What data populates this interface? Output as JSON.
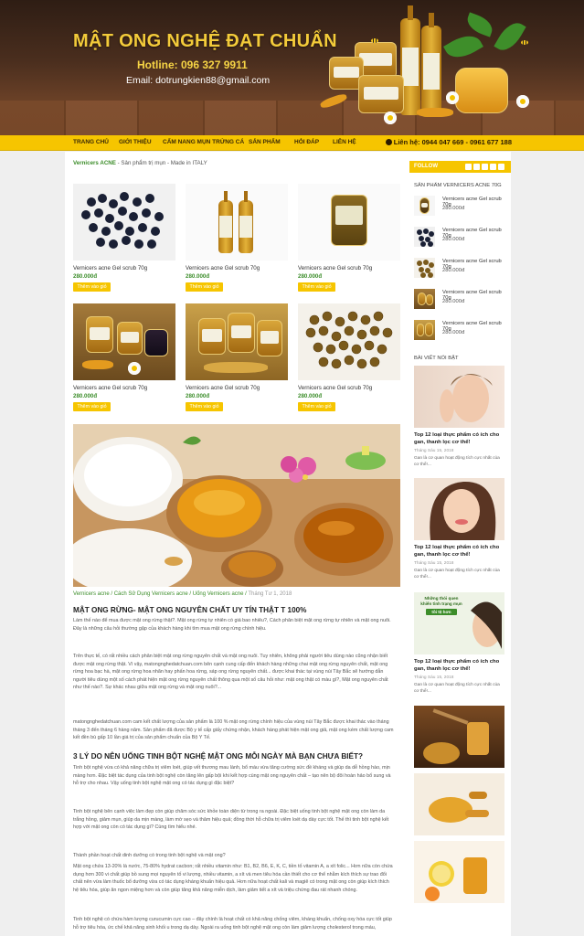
{
  "header": {
    "site_title": "MẬT ONG NGHỆ ĐẠT CHUẨN",
    "hotline": "Hotline: 096 327 9911",
    "email": "Email: dotrungkien88@gmail.com"
  },
  "nav": {
    "items": [
      "TRANG CHỦ",
      "GIỚI THIỆU",
      "CẨM NANG MỤN TRỨNG CÁ",
      "SẢN PHẨM",
      "HỎI ĐÁP",
      "LIÊN HỆ"
    ],
    "contact": "Liên hệ: 0944 047 669 - 0961 677 188"
  },
  "breadcrumb": {
    "link": "Vernicers ACNE",
    "text": "- Sản phẩm trị mụn - Made in ITALY"
  },
  "products": [
    {
      "name": "Vernicers acne Gel scrub 70g",
      "price": "280.000đ",
      "cart": "Thêm vào giỏ"
    },
    {
      "name": "Vernicers acne Gel scrub 70g",
      "price": "280.000đ",
      "cart": "Thêm vào giỏ"
    },
    {
      "name": "Vernicers acne Gel scrub 70g",
      "price": "280.000đ",
      "cart": "Thêm vào giỏ"
    },
    {
      "name": "Vernicers acne Gel scrub 70g",
      "price": "280.000đ",
      "cart": "Thêm vào giỏ"
    },
    {
      "name": "Vernicers acne Gel scrub 70g",
      "price": "280.000đ",
      "cart": "Thêm vào giỏ"
    },
    {
      "name": "Vernicers acne Gel scrub 70g",
      "price": "280.000đ",
      "cart": "Thêm vào giỏ"
    }
  ],
  "article": {
    "meta_links": "Vernicers acne / Cách Sử Dụng Vernicers acne / Uống Vernicers acne /",
    "meta_date": "Tháng Tư 1, 2018",
    "title": "MẬT ONG RỪNG- MẬT ONG NGUYÊN CHẤT UY TÍN THẬT T 100%",
    "p1": "Làm thế nào để mua được mật ong rừng thật?. Mật ong rừng tự nhiên có giá bao nhiêu?, Cách phân biệt mật ong rừng tự nhiên và mật ong nuôi. Đây là những câu hỏi thường gặp của khách hàng khi tìm mua mật ong rừng chính hiệu.",
    "p2": "Trên thực tế, có rất nhiều cách phân biệt mật ong rừng nguyên chất và mật ong nuôi. Tuy nhiên, không phải người tiêu dùng nào cũng nhận biết được mật ong rừng thật. Vì vậy, matongnghedatchuan.com bên cạnh cung cấp đến khách hàng những chai mật ong rừng nguyên chất, mật ong rừng hoa bạc hà, mật ong rừng hoa nhãn hay phấn hoa rừng, sáp ong rừng nguyên chất... được khai thác tại vùng núi Tây Bắc sẽ hướng dẫn người tiêu dùng một số cách phát hiện mật ong rừng nguyên chất thông qua một số câu hỏi như: mật ong thật có màu gì?, Mật ong nguyên chất như thế nào?. Sự khác nhau giữa mật ong rừng và mật ong nuôi?...",
    "p3": "matongnghedatchuan.com cam kết chất lượng của sản phẩm là 100 % mật ong rừng chính hiệu của vùng núi Tây Bắc được khai thác vào tháng tháng 3 đến tháng 6 hàng năm. Sản phẩm đã được Bộ y tế cấp giấy chứng nhận, khách hàng phát hiện mật ong giả, mật ong kém chất lượng cam kết đền bù gấp 10 lần giá trị của sản phẩm chuẩn của Bộ Y Tế.",
    "h2": "3 LÝ DO NÊN UỐNG TINH BỘT NGHỆ MẬT ONG MỖI NGÀY MÀ BẠN CHƯA BIẾT?",
    "p4": "Tinh bột nghệ vừa có khả năng chữa trị viêm loét, giúp vết thương mau lành, bổ máu vừa tăng cường sức đề kháng và giúp da dễ hồng hào, mịn màng hơn. Đặc biệt tác dụng của tinh bột nghệ còn tăng lên gấp bội khi kết hợp cùng mật ong nguyên chất – tạo nên bộ đôi hoàn hảo bổ sung và hỗ trợ cho nhau. Vậy uống tinh bột nghệ mật ong có tác dụng gì đặc biệt?",
    "p5": "Tinh bột nghệ bên cạnh việc làm đẹp còn giúp chăm sóc sức khỏe toàn diện từ trong ra ngoài. Đặc biệt uống tinh bột nghệ mật ong còn làm da trắng hồng, giảm mụn, giúp da mịn màng, làm mờ sẹo và thâm hiệu quả; đồng thời hỗ chữa trị viêm loét dạ dày cực tốt. Thế thì tinh bột nghệ kết hợp với mật ong còn có tác dụng gì? Cùng tìm hiểu nhé.",
    "p6": "Thành phần hoạt chất dinh dưỡng có trong tinh bột nghệ và mật ong?",
    "p7": "Mật ong chứa 13-20% là nước, 75-80% hydrat cacbon; rất nhiều vitamin như: B1, B2, B6, E, K, C, tiền tố vitamin A, a xít folic... Hơn nữa còn chứa dụng hơn 300 vi chất giúp bồ sung mọi nguyên tố vi lượng, nhiều vitamin, a xít và men tiêu hóa cần thiết cho cơ thể nhằm kích thích sự trao đổi chất nên vừa làm thuốc bổ dưỡng vừa có tác dụng kháng khuẩn hiệu quả. Hơn nữa hoạt chất kali và magiê có trong mật ong còn giúp kích thích hệ tiêu hóa, giúp ăn ngon miệng hơn và còn giúp tăng khả năng miễn dịch, làm giảm tiết a xít và triệu chứng đau rát nhanh chóng.",
    "p8": "Tinh bột nghệ có chứa hàm lượng curucumin cực cao – đây chính là hoạt chất có khả năng chống viêm, kháng khuẩn, chống oxy hóa cực tốt giúp hỗ trợ tiêu hóa, ức chế khả năng sinh khối u trong dạ dày. Ngoài ra uống tinh bột nghệ mật ong còn làm giảm lượng cholesterol trong máu,"
  },
  "sidebar": {
    "follow": "FOLLOW",
    "products_heading": "SẢN PHẨM VERNICERS ACNE 70g",
    "products": [
      {
        "name": "Vernicers acne Gel scrub 70g",
        "price": "280.000đ"
      },
      {
        "name": "Vernicers acne Gel scrub 70g",
        "price": "280.000đ"
      },
      {
        "name": "Vernicers acne Gel scrub 70g",
        "price": "280.000đ"
      },
      {
        "name": "Vernicers acne Gel scrub 70g",
        "price": "280.000đ"
      },
      {
        "name": "Vernicers acne Gel scrub 70g",
        "price": "280.000đ"
      }
    ],
    "featured_heading": "BÀI VIẾT NỔI BẬT",
    "posts": [
      {
        "title": "Top 12 loại thực phẩm có ích cho gan, thanh lọc cơ thể!",
        "date": "Tháng Sáu 15, 2018",
        "excerpt": "Gan là cơ quan hoạt động tích cực nhất của cơ thể!..."
      },
      {
        "title": "Top 12 loại thực phẩm có ích cho gan, thanh lọc cơ thể!",
        "date": "Tháng Sáu 15, 2018",
        "excerpt": "Gan là cơ quan hoạt động tích cực nhất của cơ thể!..."
      },
      {
        "title": "Top 12 loại thực phẩm có ích cho gan, thanh lọc cơ thể!",
        "date": "Tháng Sáu 15, 2018",
        "excerpt": "Gan là cơ quan hoạt động tích cực nhất của cơ thể!...",
        "banner_l1": "Những thói quen",
        "banner_l2": "khiến tình trạng mụn",
        "banner_l3": "tồi tệ hơn"
      }
    ]
  },
  "colors": {
    "accent": "#f6c500",
    "green": "#3c8d2a",
    "header_title": "#f3cb3a"
  }
}
